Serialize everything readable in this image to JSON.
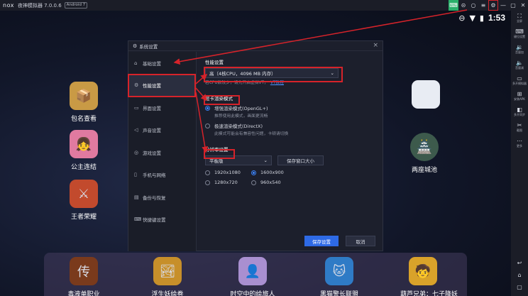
{
  "window": {
    "logo": "nox",
    "title": "夜神模拟器 7.0.0.6",
    "android_badge": "Android 7"
  },
  "titlebar_icons": [
    "keyboard-icon",
    "record-icon",
    "settings-icon",
    "menu-icon",
    "minimize-icon",
    "maximize-icon",
    "close-icon"
  ],
  "statusbar": {
    "time": "1:53"
  },
  "desktop": {
    "apps": [
      {
        "label": "包名查看",
        "icon": "📦",
        "color": "#c99a45"
      },
      {
        "label": "公主连结",
        "icon": "👧",
        "color": "#e07aa0"
      },
      {
        "label": "王者荣耀",
        "icon": "⚔",
        "color": "#c24a2d"
      },
      {
        "label": "两座城池",
        "icon": "🏯",
        "color": "#3d5a4c"
      }
    ],
    "folder_label": ""
  },
  "dock": {
    "apps": [
      {
        "label": "毒液单职业",
        "icon": "传",
        "color": "#7a3a1c"
      },
      {
        "label": "浮生妖绘卷",
        "icon": "🏞",
        "color": "#c78f2a"
      },
      {
        "label": "时空中的绘旅人",
        "icon": "👤",
        "color": "#a98fd0"
      },
      {
        "label": "黑猫警长联盟",
        "icon": "🐱",
        "color": "#2f7bc6"
      },
      {
        "label": "葫芦兄弟：七子降妖",
        "icon": "🧒",
        "color": "#d9a22a"
      }
    ]
  },
  "sidebar": [
    {
      "icon": "⛶",
      "label": "全屏"
    },
    {
      "icon": "⌨",
      "label": "键位设置"
    },
    {
      "icon": "🔉",
      "label": "音量加"
    },
    {
      "icon": "🔈",
      "label": "音量减"
    },
    {
      "icon": "▭",
      "label": "多开模拟器"
    },
    {
      "icon": "⊞",
      "label": "安装APK"
    },
    {
      "icon": "◧",
      "label": "多开同步"
    },
    {
      "icon": "✂",
      "label": "截图"
    },
    {
      "icon": "⋯",
      "label": "更多"
    },
    {
      "icon": "↩",
      "label": ""
    },
    {
      "icon": "⌂",
      "label": ""
    },
    {
      "icon": "▢",
      "label": ""
    }
  ],
  "dialog": {
    "title": "系统设置",
    "nav": [
      {
        "label": "基础设置",
        "icon": "⌂"
      },
      {
        "label": "性能设置",
        "icon": "⚙"
      },
      {
        "label": "界面设置",
        "icon": "▭"
      },
      {
        "label": "声音设置",
        "icon": "◁"
      },
      {
        "label": "游戏设置",
        "icon": "◎"
      },
      {
        "label": "手机与网络",
        "icon": "▯"
      },
      {
        "label": "备份与恢复",
        "icon": "▤"
      },
      {
        "label": "快捷键设置",
        "icon": "⌨"
      }
    ],
    "performance": {
      "title": "性能设置",
      "selected": "高（4核CPU，4096 MB 内存）",
      "hint": "若CPU数较少，请先开启虚拟VT，",
      "link": "VT教程"
    },
    "render": {
      "title": "显卡渲染模式",
      "options": [
        {
          "label": "增强渲染模式(OpenGL+)",
          "checked": true
        },
        {
          "label": "极速渲染模式(DirectX)",
          "checked": false
        }
      ],
      "hint_opengl": "推荐使用此模式，画面更流畅",
      "hint_dx": "此模式可能会有兼容性问题，卡顿请切换"
    },
    "resolution": {
      "title": "分辨率设置",
      "mode": "平板版",
      "custom_button": "保存窗口大小",
      "options": [
        {
          "label": "1920x1080",
          "checked": false
        },
        {
          "label": "1600x900",
          "checked": true
        },
        {
          "label": "1280x720",
          "checked": false
        },
        {
          "label": "960x540",
          "checked": false
        }
      ]
    },
    "save_button": "保存设置",
    "cancel_button": "取消"
  },
  "colors": {
    "accent": "#2e6ae6",
    "highlight": "#d6232a",
    "dialog_bg": "#1c1f2c"
  }
}
